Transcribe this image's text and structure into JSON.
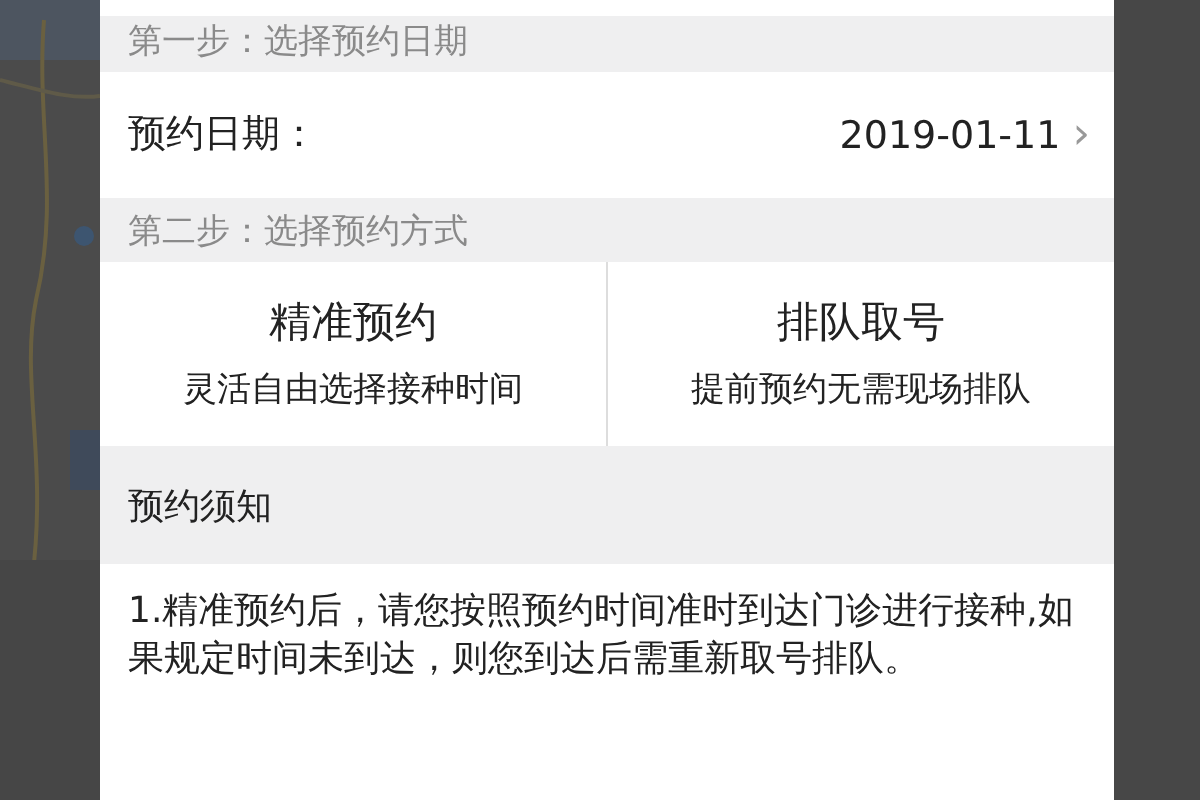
{
  "step_one": {
    "title": "第一步：选择预约日期"
  },
  "date_row": {
    "label": "预约日期：",
    "value": "2019-01-11",
    "chevron": "›"
  },
  "step_two": {
    "title": "第二步：选择预约方式"
  },
  "options": [
    {
      "title": "精准预约",
      "subtitle": "灵活自由选择接种时间"
    },
    {
      "title": "排队取号",
      "subtitle": "提前预约无需现场排队"
    }
  ],
  "notice": {
    "title": "预约须知",
    "body": "1.精准预约后，请您按照预约时间准时到达门诊进行接种,如果规定时间未到达，则您到达后需重新取号排队。"
  }
}
